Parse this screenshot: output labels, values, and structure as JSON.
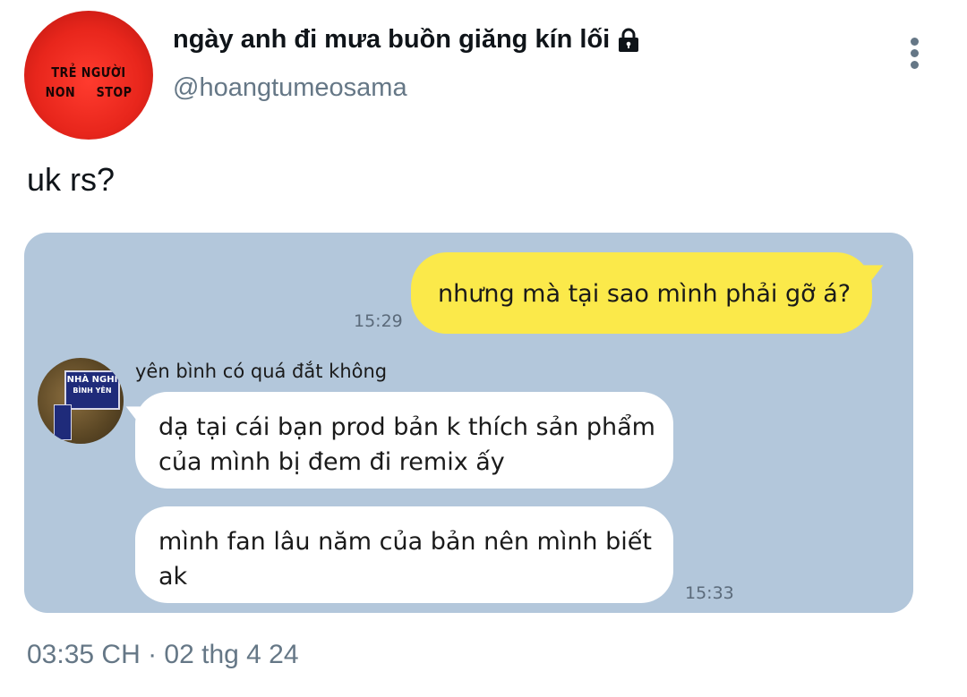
{
  "tweet": {
    "author": {
      "display_name": "ngày anh đi mưa buồn giăng kín lối",
      "handle": "@hoangtumeosama",
      "avatar_text_line1": "TRẺ NGƯỜI",
      "avatar_text_line2": "NON STOP",
      "protected_icon": "lock-icon"
    },
    "more_icon": "more-vertical-icon",
    "text": "uk rs?",
    "timestamp": "03:35 CH · 02 thg 4 24"
  },
  "media": {
    "messages": [
      {
        "direction": "outgoing",
        "text": "nhưng mà tại sao mình phải gỡ á?",
        "time": "15:29"
      },
      {
        "direction": "incoming",
        "sender": "yên bình có quá đắt không",
        "text": "dạ tại cái bạn prod bản k thích sản phẩm của mình bị đem đi remix ấy"
      },
      {
        "direction": "incoming",
        "text": "mình fan lâu năm của bản nên mình biết ak",
        "time": "15:33"
      }
    ],
    "sender_avatar_sign_line1": "NHÀ NGHỈ",
    "sender_avatar_sign_line2": "BÌNH YÊN"
  },
  "colors": {
    "chat_background": "#b3c7db",
    "outgoing_bubble": "#fbe94a",
    "incoming_bubble": "#ffffff",
    "secondary_text": "#657786"
  }
}
